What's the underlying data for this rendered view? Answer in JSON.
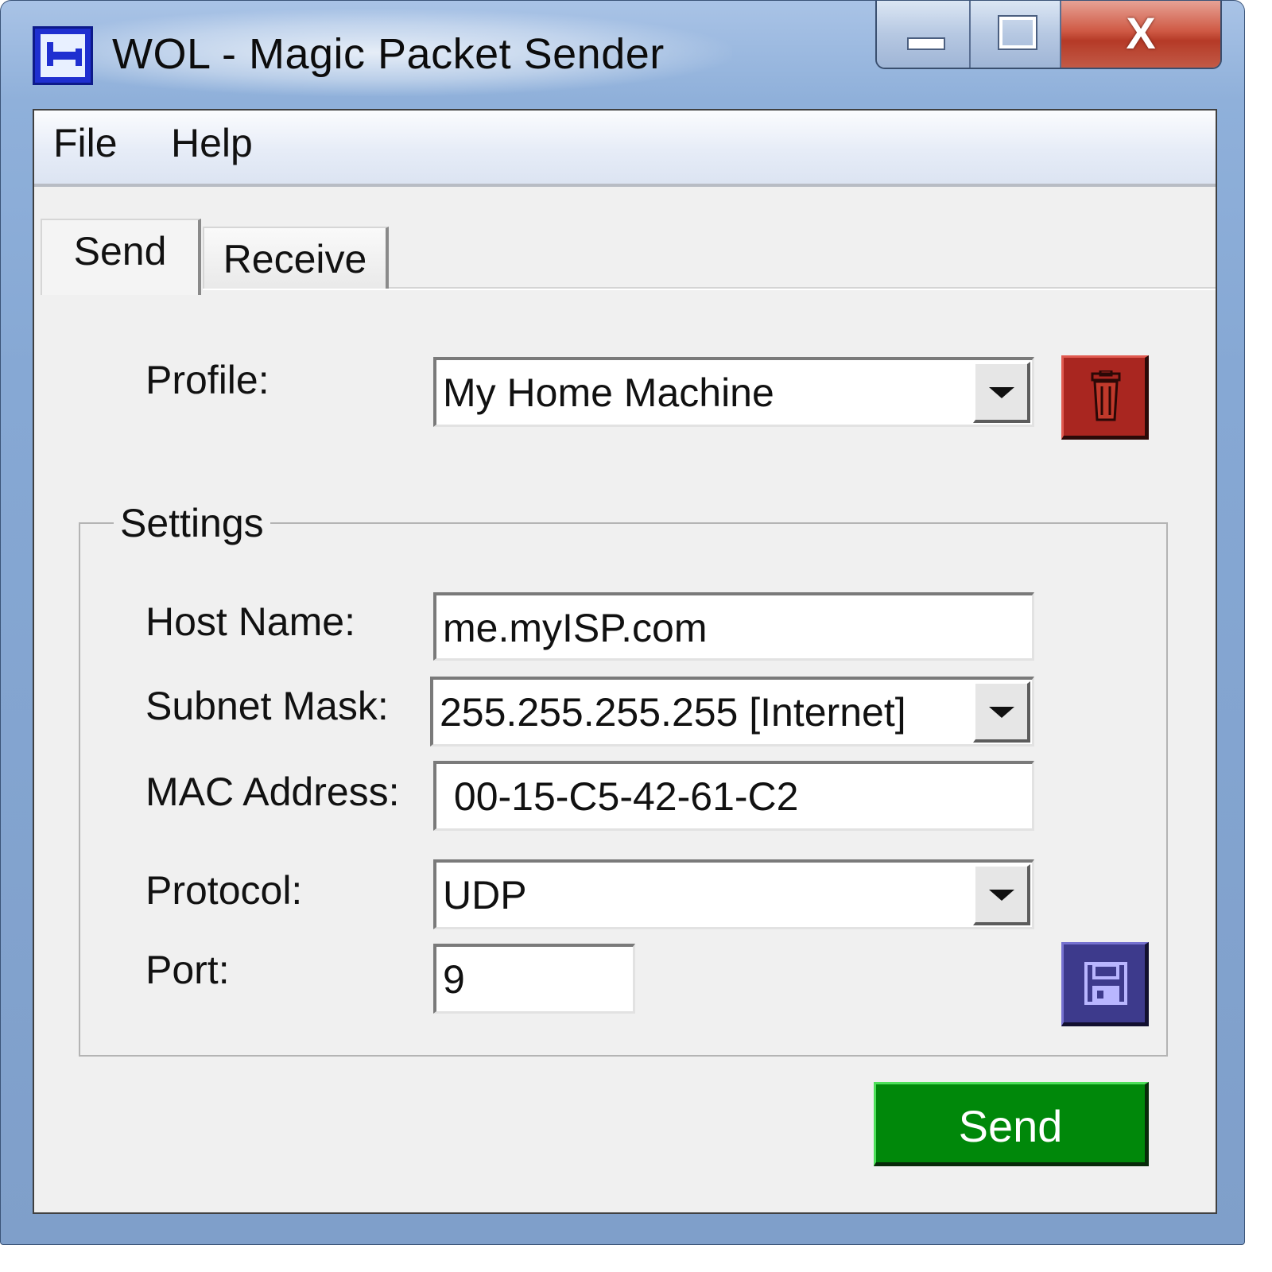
{
  "window": {
    "title": "WOL - Magic Packet Sender",
    "caption_close": "X"
  },
  "menu": {
    "file": "File",
    "help": "Help"
  },
  "tabs": [
    {
      "label": "Send",
      "selected": true
    },
    {
      "label": "Receive",
      "selected": false
    }
  ],
  "profile": {
    "label": "Profile:",
    "value": "My Home Machine"
  },
  "settings": {
    "title": "Settings",
    "host_name": {
      "label": "Host Name:",
      "value": "me.myISP.com"
    },
    "subnet_mask": {
      "label": "Subnet Mask:",
      "value": "255.255.255.255 [Internet]"
    },
    "mac_address": {
      "label": "MAC Address:",
      "value": " 00-15-C5-42-61-C2"
    },
    "protocol": {
      "label": "Protocol:",
      "value": "UDP"
    },
    "port": {
      "label": "Port:",
      "value": "9"
    }
  },
  "buttons": {
    "send": "Send",
    "delete_icon": "trash-icon",
    "save_icon": "floppy-disk-icon"
  },
  "colors": {
    "delete_button": "#a92620",
    "save_button": "#3d3a8c",
    "send_button": "#00880a"
  }
}
